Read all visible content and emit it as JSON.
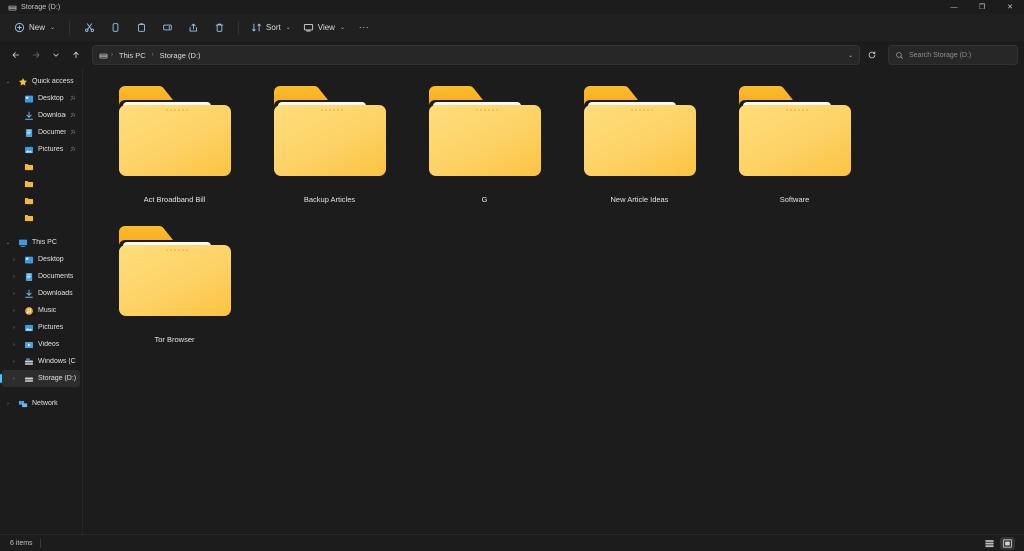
{
  "window": {
    "title": "Storage (D:)",
    "title_icon": "drive-icon",
    "minimize_glyph": "—",
    "maximize_glyph": "❐",
    "close_glyph": "✕"
  },
  "toolbar": {
    "new_label": "New",
    "caret": "⌄",
    "cut_label": "Cut",
    "copy_label": "Copy",
    "paste_label": "Paste",
    "rename_label": "Rename",
    "share_label": "Share",
    "delete_label": "Delete",
    "sort_label": "Sort",
    "view_label": "View",
    "more_label": "···"
  },
  "addressbar": {
    "back_glyph": "←",
    "forward_glyph": "→",
    "recent_glyph": "⌄",
    "up_glyph": "↑",
    "refresh_glyph": "⟳",
    "crumb_caret": "⌄",
    "crumbs": [
      {
        "label": "This PC"
      },
      {
        "label": "Storage (D:)"
      }
    ],
    "crumb_sep": "›",
    "search_placeholder": "Search Storage (D:)"
  },
  "sidebar": {
    "sections": [
      {
        "label": "Quick access",
        "icon": "star-icon",
        "expanded": true,
        "chevron": "⌄",
        "items": [
          {
            "label": "Desktop",
            "icon": "desktop-icon",
            "pinned": true,
            "chevron": ""
          },
          {
            "label": "Downloads",
            "icon": "downloads-icon",
            "pinned": true,
            "chevron": ""
          },
          {
            "label": "Documents",
            "icon": "documents-icon",
            "pinned": true,
            "chevron": ""
          },
          {
            "label": "Pictures",
            "icon": "pictures-icon",
            "pinned": true,
            "chevron": ""
          },
          {
            "label": "",
            "icon": "folder-icon",
            "pinned": false,
            "chevron": ""
          },
          {
            "label": "",
            "icon": "folder-icon",
            "pinned": false,
            "chevron": ""
          },
          {
            "label": "",
            "icon": "folder-icon",
            "pinned": false,
            "chevron": ""
          },
          {
            "label": "",
            "icon": "folder-icon",
            "pinned": false,
            "chevron": ""
          }
        ]
      },
      {
        "label": "This PC",
        "icon": "thispc-icon",
        "expanded": true,
        "chevron": "⌄",
        "items": [
          {
            "label": "Desktop",
            "icon": "desktop-icon",
            "chevron": "›",
            "selected": false
          },
          {
            "label": "Documents",
            "icon": "documents-icon",
            "chevron": "›",
            "selected": false
          },
          {
            "label": "Downloads",
            "icon": "downloads-icon",
            "chevron": "›",
            "selected": false
          },
          {
            "label": "Music",
            "icon": "music-icon",
            "chevron": "›",
            "selected": false
          },
          {
            "label": "Pictures",
            "icon": "pictures-icon",
            "chevron": "›",
            "selected": false
          },
          {
            "label": "Videos",
            "icon": "videos-icon",
            "chevron": "›",
            "selected": false
          },
          {
            "label": "Windows (C:)",
            "icon": "drive-c-icon",
            "chevron": "›",
            "selected": false
          },
          {
            "label": "Storage (D:)",
            "icon": "drive-icon",
            "chevron": "›",
            "selected": true
          }
        ]
      },
      {
        "label": "Network",
        "icon": "network-icon",
        "expanded": false,
        "chevron": "›",
        "items": []
      }
    ]
  },
  "files": [
    {
      "name": "Act Broadband Bill",
      "type": "folder"
    },
    {
      "name": "Backup Articles",
      "type": "folder"
    },
    {
      "name": "G",
      "type": "folder"
    },
    {
      "name": "New Article Ideas",
      "type": "folder"
    },
    {
      "name": "Software",
      "type": "folder"
    },
    {
      "name": "Tor Browser",
      "type": "folder"
    }
  ],
  "statusbar": {
    "item_count": "6 items",
    "details_view_label": "Details view",
    "large_icons_view_label": "Large icons view"
  },
  "colors": {
    "accent": "#4cc2ff",
    "window_bg": "#1c1c1c",
    "toolbar_bg": "#202020",
    "folder_front": "#fcd462",
    "folder_tab": "#f9b233",
    "folder_sheet": "#f7f7f3",
    "text": "#e6e6e6",
    "text_dim": "#8e8e8e",
    "selection": "#2d2d2d"
  }
}
